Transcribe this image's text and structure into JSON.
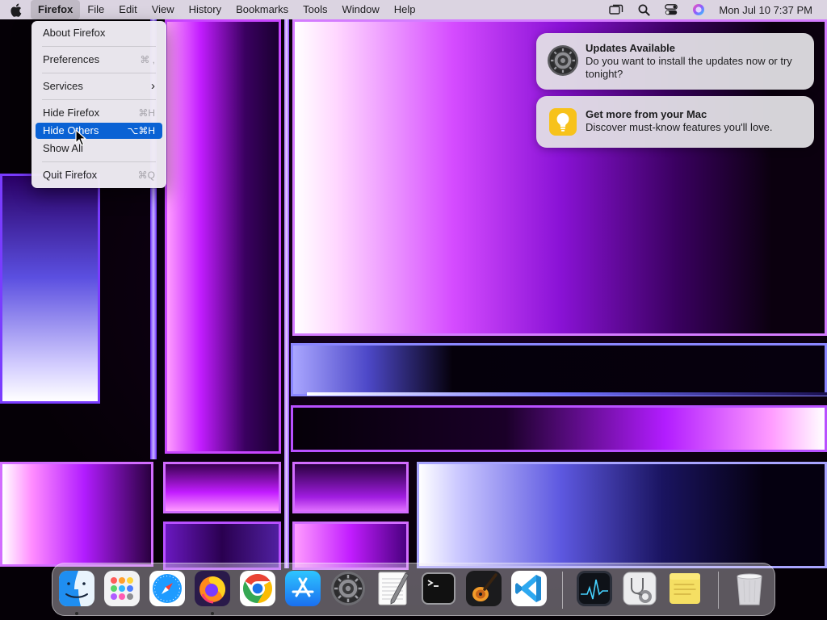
{
  "menubar": {
    "apple_icon": "apple-logo-icon",
    "items": [
      {
        "label": "Firefox",
        "app": true,
        "active": true
      },
      {
        "label": "File"
      },
      {
        "label": "Edit"
      },
      {
        "label": "View"
      },
      {
        "label": "History"
      },
      {
        "label": "Bookmarks"
      },
      {
        "label": "Tools"
      },
      {
        "label": "Window"
      },
      {
        "label": "Help"
      }
    ],
    "status_icons": [
      "screen-mirroring-icon",
      "spotlight-search-icon",
      "control-center-icon",
      "siri-icon"
    ],
    "clock": "Mon Jul 10  7:37 PM"
  },
  "app_menu": {
    "items": [
      {
        "label": "About Firefox",
        "shortcut": ""
      },
      {
        "label": "Preferences",
        "shortcut": "⌘ ,"
      },
      {
        "label": "Services",
        "shortcut": "›"
      },
      {
        "label": "Hide Firefox",
        "shortcut": "⌘H"
      },
      {
        "label": "Hide Others",
        "shortcut": "⌥⌘H",
        "highlighted": true
      },
      {
        "label": "Show All",
        "shortcut": ""
      },
      {
        "label": "Quit Firefox",
        "shortcut": "⌘Q"
      }
    ]
  },
  "notifications": [
    {
      "title": "Updates Available",
      "body": "Do you want to install the updates now or try tonight?",
      "icon": "system-settings-gear-icon"
    },
    {
      "title": "Get more from your Mac",
      "body": "Discover must-know features you'll love.",
      "icon": "tips-lightbulb-icon"
    }
  ],
  "dock": {
    "apps": [
      {
        "name": "Finder",
        "icon": "finder-icon",
        "running": true
      },
      {
        "name": "Launchpad",
        "icon": "launchpad-icon",
        "running": false
      },
      {
        "name": "Safari",
        "icon": "safari-icon",
        "running": false
      },
      {
        "name": "Firefox",
        "icon": "firefox-icon",
        "running": true
      },
      {
        "name": "Chrome",
        "icon": "chrome-icon",
        "running": false
      },
      {
        "name": "App Store",
        "icon": "app-store-icon",
        "running": false
      },
      {
        "name": "System Settings",
        "icon": "system-settings-icon",
        "running": false
      },
      {
        "name": "TextEdit",
        "icon": "textedit-icon",
        "running": false
      },
      {
        "name": "Terminal",
        "icon": "terminal-icon",
        "running": false
      },
      {
        "name": "GarageBand",
        "icon": "garageband-icon",
        "running": false
      },
      {
        "name": "Visual Studio Code",
        "icon": "vscode-icon",
        "running": false
      },
      {
        "name": "Activity Monitor",
        "icon": "activity-monitor-icon",
        "running": false
      },
      {
        "name": "Disk Utility",
        "icon": "disk-utility-icon",
        "running": false
      },
      {
        "name": "Stickies",
        "icon": "stickies-icon",
        "running": false
      },
      {
        "name": "Trash",
        "icon": "trash-icon",
        "running": false
      }
    ]
  },
  "colors": {
    "menu_highlight": "#0a62d4",
    "wallpaper_accent": "#c21cff"
  }
}
